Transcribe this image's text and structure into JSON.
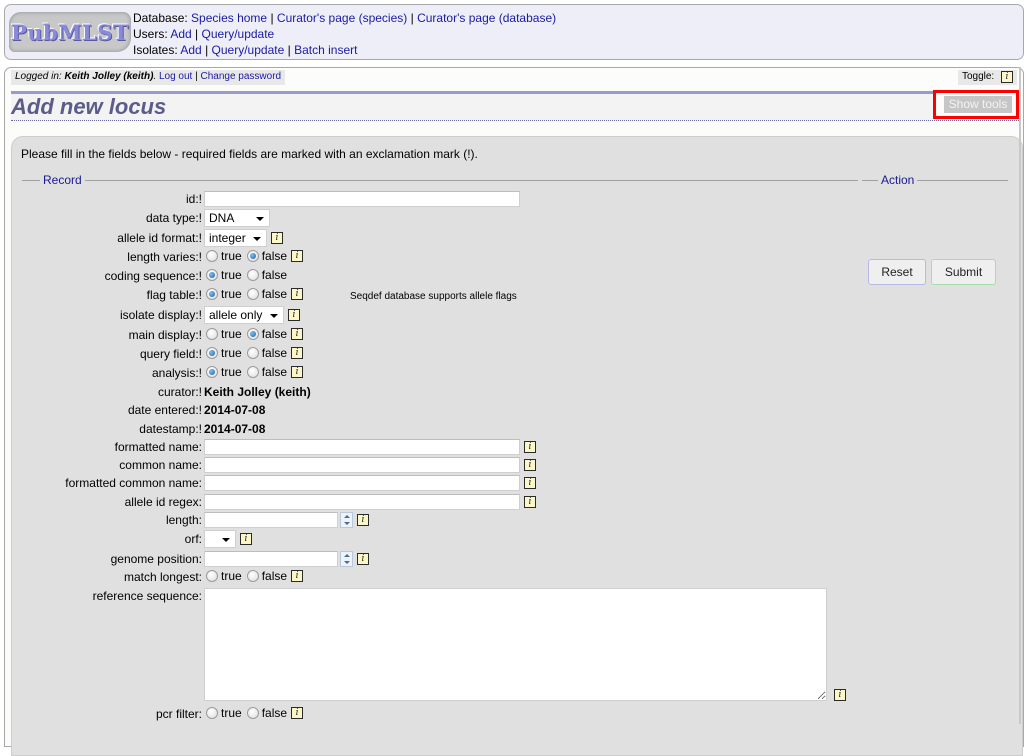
{
  "header": {
    "logo_text": "PubMLST",
    "rows": [
      {
        "label": "Database:",
        "links": [
          "Species home",
          "Curator's page (species)",
          "Curator's page (database)"
        ]
      },
      {
        "label": "Users:",
        "links": [
          "Add",
          "Query/update"
        ]
      },
      {
        "label": "Isolates:",
        "links": [
          "Add",
          "Query/update",
          "Batch insert"
        ]
      }
    ]
  },
  "login": {
    "prefix": "Logged in:",
    "user": "Keith Jolley (keith)",
    "suffix": ".",
    "logout": "Log out",
    "change_password": "Change password"
  },
  "toggle": {
    "label": "Toggle:",
    "icon": "info-icon"
  },
  "page": {
    "title": "Add new locus",
    "show_tools": "Show tools"
  },
  "form": {
    "instructions": "Please fill in the fields below - required fields are marked with an exclamation mark (!).",
    "record_legend": "Record",
    "action_legend": "Action",
    "reset_label": "Reset",
    "submit_label": "Submit",
    "true_label": "true",
    "false_label": "false",
    "fields": {
      "id": {
        "label": "id:!",
        "value": ""
      },
      "data_type": {
        "label": "data type:!",
        "value": "DNA"
      },
      "allele_id_format": {
        "label": "allele id format:!",
        "value": "integer"
      },
      "length_varies": {
        "label": "length varies:!",
        "value": "false"
      },
      "coding_sequence": {
        "label": "coding sequence:!",
        "value": "true"
      },
      "flag_table": {
        "label": "flag table:!",
        "value": "true",
        "note": "Seqdef database supports allele flags"
      },
      "isolate_display": {
        "label": "isolate display:!",
        "value": "allele only"
      },
      "main_display": {
        "label": "main display:!",
        "value": "false"
      },
      "query_field": {
        "label": "query field:!",
        "value": "true"
      },
      "analysis": {
        "label": "analysis:!",
        "value": "true"
      },
      "curator": {
        "label": "curator:!",
        "value": "Keith Jolley (keith)"
      },
      "date_entered": {
        "label": "date entered:!",
        "value": "2014-07-08"
      },
      "datestamp": {
        "label": "datestamp:!",
        "value": "2014-07-08"
      },
      "formatted_name": {
        "label": "formatted name:",
        "value": ""
      },
      "common_name": {
        "label": "common name:",
        "value": ""
      },
      "formatted_common_name": {
        "label": "formatted common name:",
        "value": ""
      },
      "allele_id_regex": {
        "label": "allele id regex:",
        "value": ""
      },
      "length": {
        "label": "length:",
        "value": ""
      },
      "orf": {
        "label": "orf:",
        "value": ""
      },
      "genome_position": {
        "label": "genome position:",
        "value": ""
      },
      "match_longest": {
        "label": "match longest:",
        "value": ""
      },
      "reference_sequence": {
        "label": "reference sequence:",
        "value": ""
      },
      "pcr_filter": {
        "label": "pcr filter:",
        "value": ""
      }
    }
  }
}
